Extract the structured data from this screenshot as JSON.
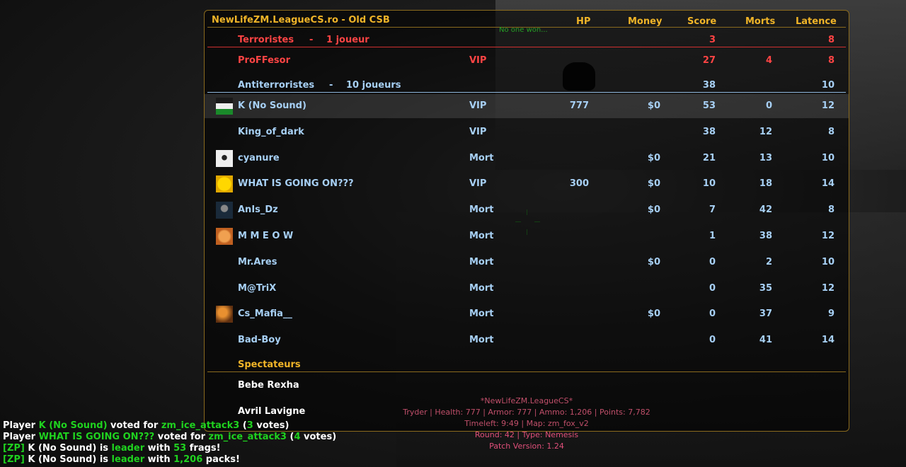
{
  "colors": {
    "gold": "#f0b428",
    "ter": "#ff4444",
    "ct": "#a7d0f5",
    "spec": "#ffffff",
    "info": "#c04f6a",
    "chat_green": "#1fd21f"
  },
  "scoreboard": {
    "server_title": "NewLifeZM.LeagueCS.ro - Old CSB",
    "columns": {
      "hp": "HP",
      "money": "Money",
      "score": "Score",
      "morts": "Morts",
      "latence": "Latence"
    },
    "win_message": "No one won...",
    "terrorists": {
      "label": "Terroristes",
      "sep": "-",
      "count": "1 joueur",
      "score": "3",
      "latence": "8"
    },
    "ter_players": [
      {
        "name": "ProFFesor",
        "status": "VIP",
        "hp": "",
        "money": "",
        "score": "27",
        "morts": "4",
        "latence": "8"
      }
    ],
    "ct": {
      "label": "Antiterroristes",
      "sep": "-",
      "count": "10 joueurs",
      "score": "38",
      "latence": "10"
    },
    "ct_players": [
      {
        "name": "K (No Sound)",
        "status": "VIP",
        "hp": "777",
        "money": "$0",
        "score": "53",
        "morts": "0",
        "latence": "12"
      },
      {
        "name": "King_of_dark",
        "status": "VIP",
        "hp": "",
        "money": "",
        "score": "38",
        "morts": "12",
        "latence": "8"
      },
      {
        "name": "cyanure",
        "status": "Mort",
        "hp": "",
        "money": "$0",
        "score": "21",
        "morts": "13",
        "latence": "10"
      },
      {
        "name": "WHAT IS GOING ON???",
        "status": "VIP",
        "hp": "300",
        "money": "$0",
        "score": "10",
        "morts": "18",
        "latence": "14"
      },
      {
        "name": "AnIs_Dz",
        "status": "Mort",
        "hp": "",
        "money": "$0",
        "score": "7",
        "morts": "42",
        "latence": "8"
      },
      {
        "name": "M M E O W",
        "status": "Mort",
        "hp": "",
        "money": "",
        "score": "1",
        "morts": "38",
        "latence": "12"
      },
      {
        "name": "Mr.Ares",
        "status": "Mort",
        "hp": "",
        "money": "$0",
        "score": "0",
        "morts": "2",
        "latence": "10"
      },
      {
        "name": "M@TriX",
        "status": "Mort",
        "hp": "",
        "money": "",
        "score": "0",
        "morts": "35",
        "latence": "12"
      },
      {
        "name": "Cs_Mafia__",
        "status": "Mort",
        "hp": "",
        "money": "$0",
        "score": "0",
        "morts": "37",
        "latence": "9"
      },
      {
        "name": "Bad-Boy",
        "status": "Mort",
        "hp": "",
        "money": "",
        "score": "0",
        "morts": "41",
        "latence": "14"
      }
    ],
    "spectators_label": "Spectateurs",
    "spectators": [
      "Bebe Rexha",
      "Avril Lavigne"
    ]
  },
  "server_info": {
    "line1": "*NewLifeZM.LeagueCS*",
    "line2": "Tryder | Health: 777 | Armor: 777 | Ammo: 1,206 | Points: 7,782",
    "line3": "Timeleft: 9:49 | Map: zm_fox_v2",
    "line4": "Round: 42 | Type: Nemesis",
    "line5": "Patch Version: 1.24"
  },
  "chat": {
    "l1": {
      "a": "Player ",
      "b": "K (No Sound)",
      "c": " voted for ",
      "d": "zm_ice_attack3",
      "e": " (",
      "f": "3",
      "g": " votes)"
    },
    "l2": {
      "a": "Player ",
      "b": "WHAT IS GOING ON???",
      "c": " voted for ",
      "d": "zm_ice_attack3",
      "e": " (",
      "f": "4",
      "g": " votes)"
    },
    "l3": {
      "a": "[ZP]",
      "b": " K (No Sound) is ",
      "c": "leader",
      "d": " with ",
      "e": "53",
      "f": " frags!"
    },
    "l4": {
      "a": "[ZP]",
      "b": " K (No Sound) is ",
      "c": "leader",
      "d": " with ",
      "e": "1,206",
      "f": " packs!"
    }
  }
}
